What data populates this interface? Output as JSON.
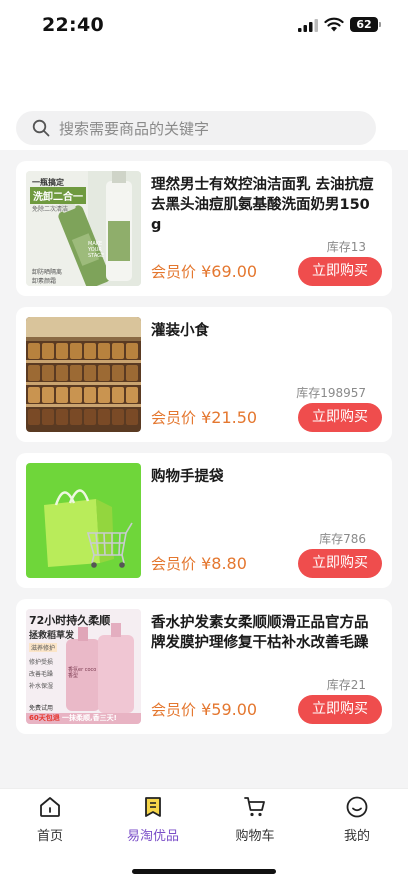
{
  "status_bar": {
    "time": "22:40",
    "battery": "62"
  },
  "search": {
    "placeholder": "搜索需要商品的关键字"
  },
  "products": [
    {
      "title": "理然男士有效控油洁面乳 去油抗痘去黑头油痘肌氨基酸洗面奶男150g",
      "price_label": "会员价",
      "price": "¥69.00",
      "stock": "库存13",
      "buy_label": "立即购买",
      "image_texts": [
        "一瓶搞定",
        "洗卸二合一",
        "免除二次清洁",
        "卸防晒隔离",
        "卸素颜霜",
        "MAKE YOUR STAGE"
      ]
    },
    {
      "title": "灌装小食",
      "price_label": "会员价",
      "price": "¥21.50",
      "stock": "库存198957",
      "buy_label": "立即购买"
    },
    {
      "title": "购物手提袋",
      "price_label": "会员价",
      "price": "¥8.80",
      "stock": "库存786",
      "buy_label": "立即购买"
    },
    {
      "title": "香水护发素女柔顺顺滑正品官方品牌发膜护理修复干枯补水改善毛躁",
      "price_label": "会员价",
      "price": "¥59.00",
      "stock": "库存21",
      "buy_label": "立即购买",
      "image_texts": [
        "72小时持久柔顺",
        "拯救稻草发",
        "滋养修护",
        "修护受损",
        "改善毛躁",
        "补水保湿",
        "香氛er coco香型",
        "免费试用",
        "60天包退",
        "一抹柔顺,香三天!"
      ]
    }
  ],
  "tabbar": {
    "items": [
      {
        "label": "首页",
        "icon": "home-icon"
      },
      {
        "label": "易淘优品",
        "icon": "bookmark-icon"
      },
      {
        "label": "购物车",
        "icon": "cart-icon"
      },
      {
        "label": "我的",
        "icon": "smile-icon"
      }
    ],
    "active_index": 1
  },
  "colors": {
    "accent": "#7b4fc8",
    "price": "#e4772f",
    "buy_button": "#ef4d4d"
  }
}
